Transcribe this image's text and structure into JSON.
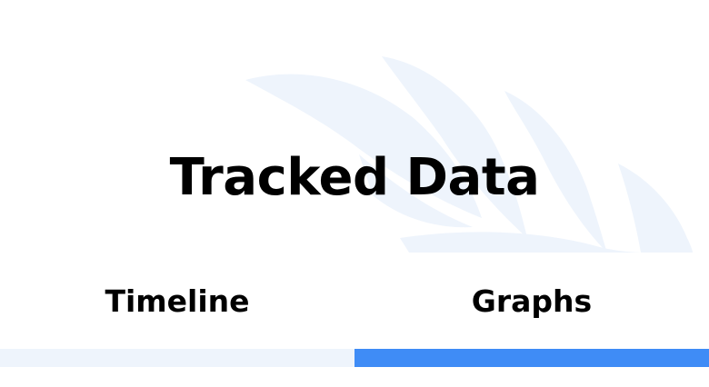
{
  "page": {
    "title": "Tracked Data"
  },
  "tabs": [
    {
      "label": "Timeline",
      "active": false
    },
    {
      "label": "Graphs",
      "active": true
    }
  ],
  "colors": {
    "accent": "#3f8cf6",
    "inactive_indicator": "#eef4fc",
    "decoration": "#eef4fc",
    "text": "#000000"
  },
  "icons": {
    "background": "leaf-decoration-icon"
  }
}
